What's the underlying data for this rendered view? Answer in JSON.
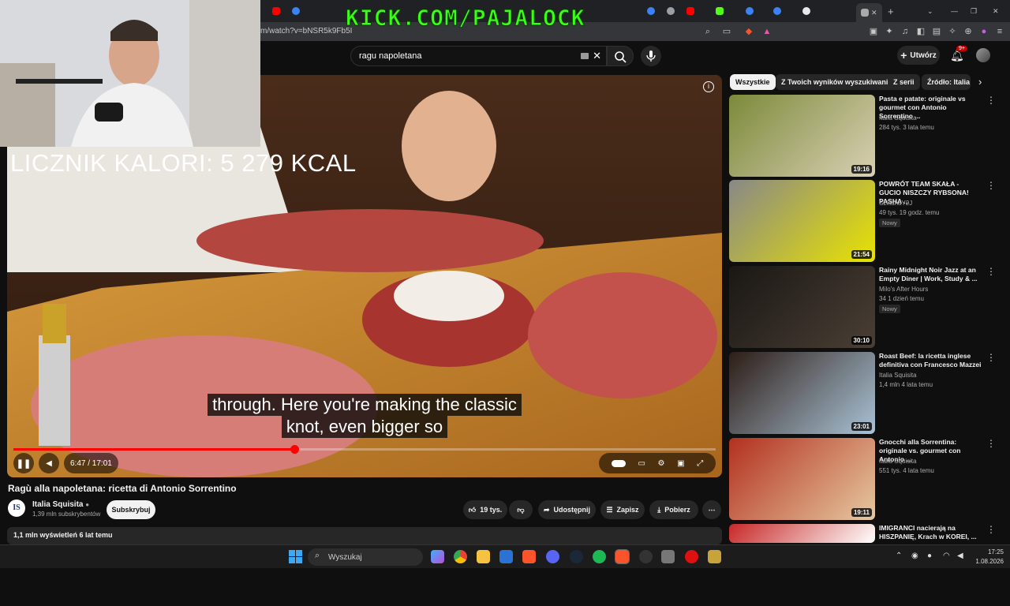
{
  "browser": {
    "url": "m/watch?v=bNSR5k9Fb5I"
  },
  "overlay": {
    "kick_text": "KICK.COM/PAJALOCK",
    "calorie_counter": "LICZNIK KALORI: 5 279 KCAL"
  },
  "youtube": {
    "search_value": "ragu napoletana",
    "create_label": "Utwórz",
    "notif_count": "9+"
  },
  "player": {
    "caption_line1": "through. Here you're making the classic",
    "caption_line2": "knot, even bigger so",
    "time": "6:47 / 17:01",
    "progress": 0.4
  },
  "video": {
    "title": "Ragù alla napoletana: ricetta di Antonio Sorrentino",
    "channel": "Italia Squisita",
    "channel_initials": "IS",
    "subscribers": "1,39 mln subskrybentów",
    "subscribe_label": "Subskrybuj",
    "likes": "19 tys.",
    "share_label": "Udostępnij",
    "save_label": "Zapisz",
    "download_label": "Pobierz",
    "views": "1,1 mln wyświetleń  6 lat temu"
  },
  "chips": [
    "Wszystkie",
    "Z Twoich wyników wyszukiwania",
    "Z serii",
    "Źródło: Italia S"
  ],
  "recommendations": [
    {
      "title": "Pasta e patate: originale vs gourmet con Antonio Sorrentino ...",
      "channel": "Italia Squisita",
      "meta": "284 tys.   3 lata temu",
      "duration": "19:16",
      "badge": "",
      "color1": "#7c8a3a",
      "color2": "#d9d0b4"
    },
    {
      "title": "POWRÓT TEAM SKAŁA - GUCIO NISZCZY RYBSONA! PASHA ...",
      "channel": "SzklanaY2J",
      "meta": "49 tys.   19 godz. temu",
      "duration": "21:54",
      "badge": "Nowy",
      "color1": "#888888",
      "color2": "#e9e300"
    },
    {
      "title": "Rainy Midnight Noir Jazz at an Empty Diner | Work, Study & ...",
      "channel": "Milo's After Hours",
      "meta": "34   1 dzień temu",
      "duration": "30:10",
      "badge": "Nowy",
      "color1": "#1a1714",
      "color2": "#4a3f35"
    },
    {
      "title": "Roast Beef: la ricetta inglese definitiva con Francesco Mazzei",
      "channel": "Italia Squisita",
      "meta": "1,4 mln   4 lata temu",
      "duration": "23:01",
      "badge": "",
      "color1": "#2d1d16",
      "color2": "#a9c3d6"
    },
    {
      "title": "Gnocchi alla Sorrentina: originale vs. gourmet con Antonio ...",
      "channel": "Italia Squisita",
      "meta": "551 tys.   4 lata temu",
      "duration": "19:11",
      "badge": "",
      "color1": "#b3301f",
      "color2": "#e6c9a0"
    },
    {
      "title": "IMIGRANCI nacierają na HISZPANIĘ, Krach w KOREI, ...",
      "channel": "",
      "meta": "",
      "duration": "",
      "badge": "",
      "color1": "#c82828",
      "color2": "#ffffff"
    }
  ],
  "taskbar": {
    "search_placeholder": "Wyszukaj",
    "time": "17:25",
    "date": "1.08.2026"
  },
  "colors": {
    "accent": "#ff0000",
    "kick_green": "#39ff14"
  }
}
